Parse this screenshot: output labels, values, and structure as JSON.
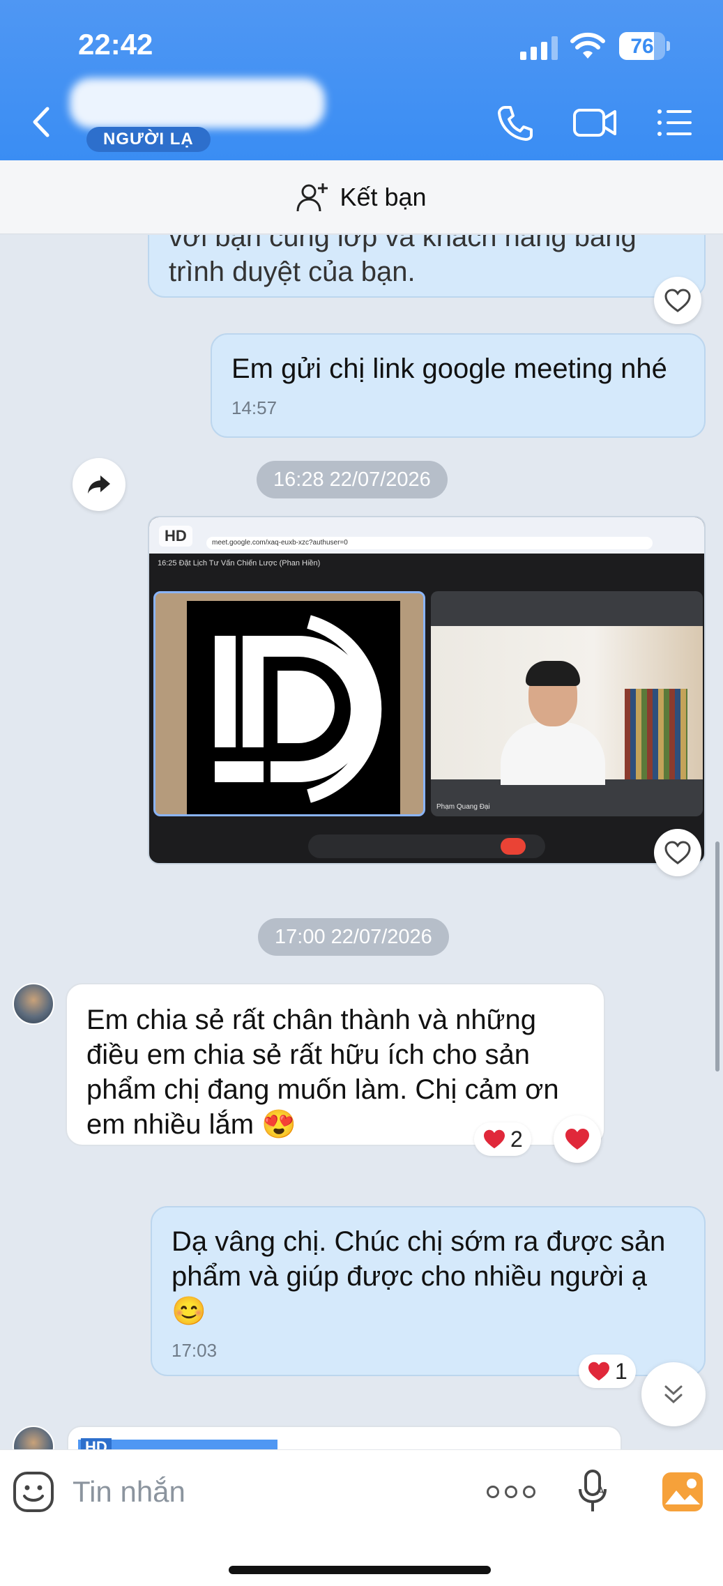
{
  "status_bar": {
    "time": "22:42",
    "battery": "76",
    "battery_level": 0.76
  },
  "header": {
    "stranger_badge": "NGƯỜI LẠ"
  },
  "add_friend": {
    "label": "Kết bạn"
  },
  "messages": {
    "m1_partial": "với bạn cùng lớp và khách hàng bằng trình duyệt của bạn.",
    "m2": {
      "text": "Em gửi chị link google meeting nhé",
      "time": "14:57"
    },
    "date1": "16:28 22/07/2026",
    "screenshot": {
      "hd": "HD",
      "url": "meet.google.com/xaq-euxb-xzc?authuser=0",
      "meeting_title": "16:25  Đặt Lịch Tư Vấn Chiến Lược (Phan Hiền)",
      "participant": "Phạm Quang Đại"
    },
    "date2": "17:00 22/07/2026",
    "m3": {
      "text": "Em chia sẻ rất chân thành và những điều em chia sẻ rất hữu ích cho sản phẩm chị đang muốn làm. Chị cảm ơn em nhiều lắm 😍",
      "reaction_count": "2"
    },
    "m4": {
      "text": "Dạ vâng chị. Chúc chị sớm ra được sản phẩm và giúp được cho nhiều người ạ 😊",
      "time": "17:03",
      "reaction_count": "1"
    },
    "m5_partial_hd": "HD"
  },
  "input": {
    "placeholder": "Tin nhắn"
  },
  "colors": {
    "header": "#3a8df3",
    "outgoing_bubble": "#d5e9fb",
    "incoming_bubble": "#ffffff",
    "background": "#e2e8f0",
    "heart": "#e0283a"
  },
  "icons": [
    "back-icon",
    "phone-icon",
    "video-call-icon",
    "list-menu-icon",
    "add-friend-icon",
    "heart-icon",
    "forward-icon",
    "chevron-down-icon",
    "sticker-icon",
    "more-icon",
    "mic-icon",
    "image-icon"
  ]
}
